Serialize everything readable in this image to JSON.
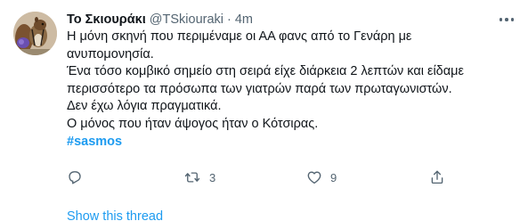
{
  "tweet": {
    "display_name": "Το Σκιουράκι",
    "handle": "@TSkiouraki",
    "separator": "·",
    "time": "4m",
    "body_lines": [
      "Η μόνη σκηνή που περιμέναμε οι ΑΑ φανς από το Γενάρη με",
      "ανυπομονησία.",
      "Ένα τόσο κομβικό σημείο στη σειρά είχε διάρκεια 2 λεπτών και είδαμε",
      "περισσότερο τα πρόσωπα των γιατρών παρά των πρωταγωνιστών.",
      "Δεν έχω λόγια πραγματικά.",
      "Ο μόνος που ήταν άψογος ήταν ο Κότσιρας."
    ],
    "hashtag": "#sasmos",
    "actions": {
      "reply_icon": "reply-icon",
      "retweet_icon": "retweet-icon",
      "retweet_count": "3",
      "like_icon": "heart-icon",
      "like_count": "9",
      "share_icon": "share-icon"
    },
    "show_thread": "Show this thread"
  },
  "colors": {
    "text": "#0f1419",
    "secondary": "#536471",
    "accent": "#1d9bf0"
  }
}
